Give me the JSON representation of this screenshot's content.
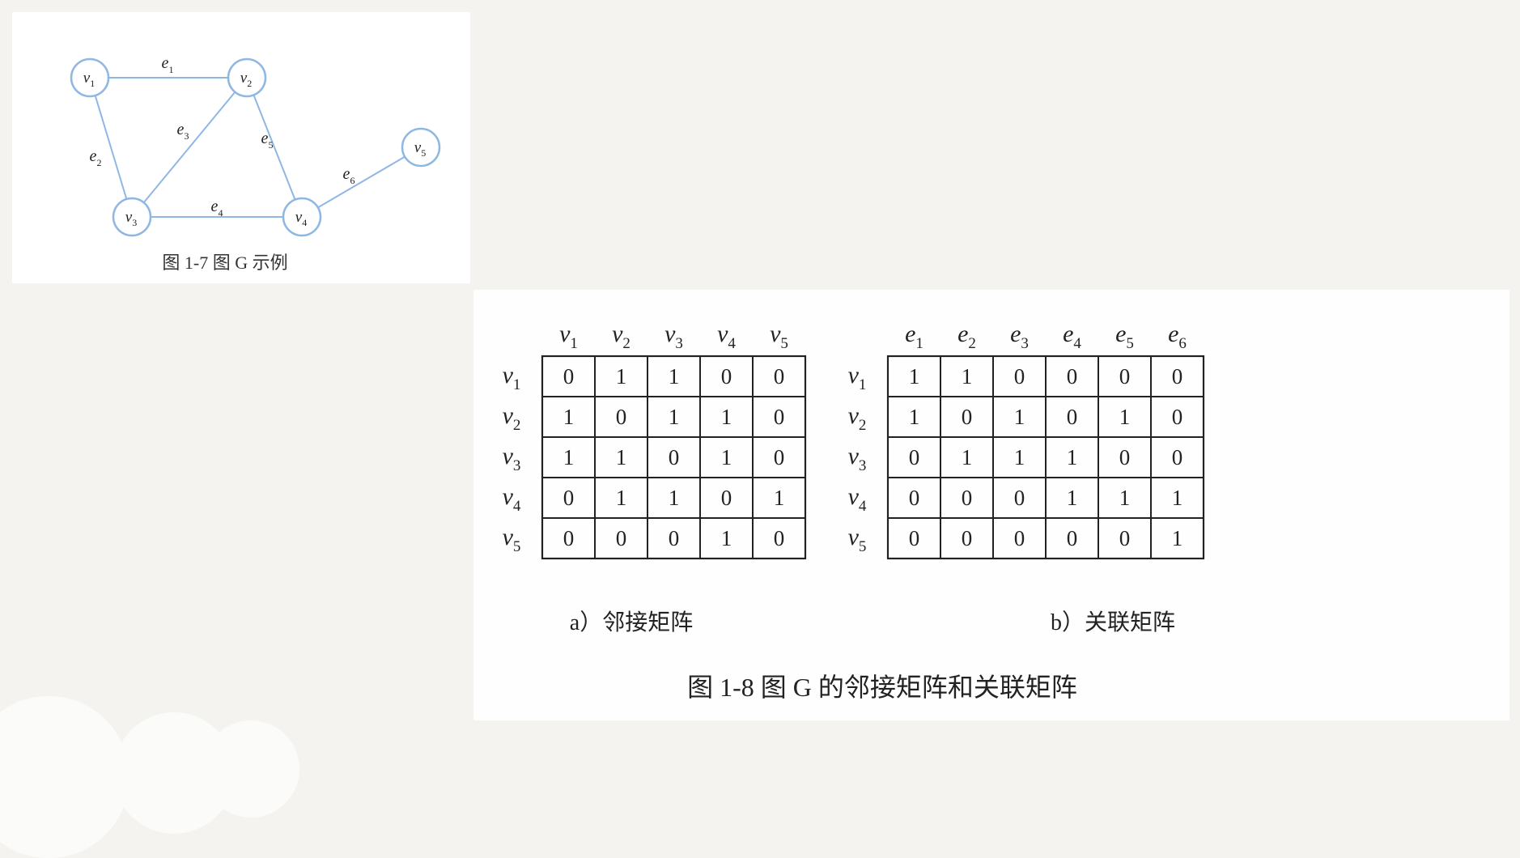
{
  "figure_1_7": {
    "caption": "图 1-7 图 G 示例",
    "vertices": [
      {
        "id": "v1",
        "base": "v",
        "sub": "1"
      },
      {
        "id": "v2",
        "base": "v",
        "sub": "2"
      },
      {
        "id": "v3",
        "base": "v",
        "sub": "3"
      },
      {
        "id": "v4",
        "base": "v",
        "sub": "4"
      },
      {
        "id": "v5",
        "base": "v",
        "sub": "5"
      }
    ],
    "edges": [
      {
        "id": "e1",
        "base": "e",
        "sub": "1",
        "from": "v1",
        "to": "v2"
      },
      {
        "id": "e2",
        "base": "e",
        "sub": "2",
        "from": "v1",
        "to": "v3"
      },
      {
        "id": "e3",
        "base": "e",
        "sub": "3",
        "from": "v3",
        "to": "v2"
      },
      {
        "id": "e4",
        "base": "e",
        "sub": "4",
        "from": "v3",
        "to": "v4"
      },
      {
        "id": "e5",
        "base": "e",
        "sub": "5",
        "from": "v2",
        "to": "v4"
      },
      {
        "id": "e6",
        "base": "e",
        "sub": "6",
        "from": "v4",
        "to": "v5"
      }
    ],
    "node_color": "#8fb7e3",
    "edge_color": "#8fb7e3"
  },
  "figure_1_8": {
    "caption": "图 1-8 图 G 的邻接矩阵和关联矩阵",
    "adjacency": {
      "caption": "a）邻接矩阵",
      "col_headers": [
        [
          "v",
          "1"
        ],
        [
          "v",
          "2"
        ],
        [
          "v",
          "3"
        ],
        [
          "v",
          "4"
        ],
        [
          "v",
          "5"
        ]
      ],
      "row_headers": [
        [
          "v",
          "1"
        ],
        [
          "v",
          "2"
        ],
        [
          "v",
          "3"
        ],
        [
          "v",
          "4"
        ],
        [
          "v",
          "5"
        ]
      ],
      "cells": [
        [
          "0",
          "1",
          "1",
          "0",
          "0"
        ],
        [
          "1",
          "0",
          "1",
          "1",
          "0"
        ],
        [
          "1",
          "1",
          "0",
          "1",
          "0"
        ],
        [
          "0",
          "1",
          "1",
          "0",
          "1"
        ],
        [
          "0",
          "0",
          "0",
          "1",
          "0"
        ]
      ]
    },
    "incidence": {
      "caption": "b）关联矩阵",
      "col_headers": [
        [
          "e",
          "1"
        ],
        [
          "e",
          "2"
        ],
        [
          "e",
          "3"
        ],
        [
          "e",
          "4"
        ],
        [
          "e",
          "5"
        ],
        [
          "e",
          "6"
        ]
      ],
      "row_headers": [
        [
          "v",
          "1"
        ],
        [
          "v",
          "2"
        ],
        [
          "v",
          "3"
        ],
        [
          "v",
          "4"
        ],
        [
          "v",
          "5"
        ]
      ],
      "cells": [
        [
          "1",
          "1",
          "0",
          "0",
          "0",
          "0"
        ],
        [
          "1",
          "0",
          "1",
          "0",
          "1",
          "0"
        ],
        [
          "0",
          "1",
          "1",
          "1",
          "0",
          "0"
        ],
        [
          "0",
          "0",
          "0",
          "1",
          "1",
          "1"
        ],
        [
          "0",
          "0",
          "0",
          "0",
          "0",
          "1"
        ]
      ]
    }
  }
}
